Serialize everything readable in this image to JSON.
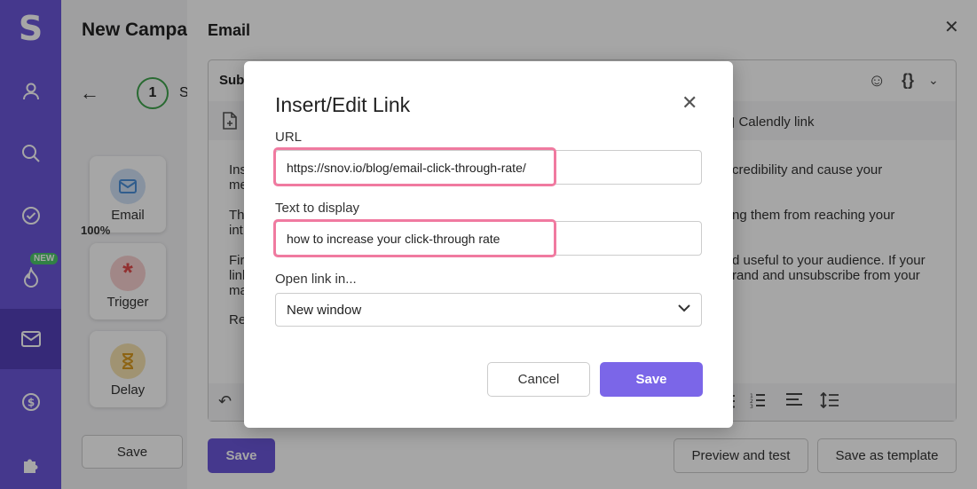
{
  "sidebar": {
    "logo": "S",
    "new_badge": "NEW"
  },
  "campaign": {
    "title": "New Campaign",
    "step_number": "1",
    "step_label_partial": "S",
    "nodes": [
      {
        "label": "Email",
        "icon": "envelope-icon",
        "color": "#4a90d9"
      },
      {
        "label": "Trigger",
        "icon": "asterisk-icon",
        "color": "#e04a4a"
      },
      {
        "label": "Delay",
        "icon": "hourglass-icon",
        "color": "#d99a1e"
      }
    ],
    "percent": "100%",
    "save_label": "Save"
  },
  "email_panel": {
    "title": "Email",
    "subject_label": "Subj",
    "calendly_label": "Calendly link",
    "body_fragments": [
      "Ins",
      "me",
      "Th",
      "int",
      "Fir",
      "link",
      "ma",
      "Re",
      "credibility and cause your",
      "ng them from reaching your",
      "d useful to your audience. If your",
      "rand and unsubscribe from your"
    ],
    "save_label": "Save",
    "preview_label": "Preview and test",
    "template_label": "Save as template"
  },
  "dialog": {
    "title": "Insert/Edit Link",
    "url_label": "URL",
    "url_value": "https://snov.io/blog/email-click-through-rate/",
    "text_label": "Text to display",
    "text_value": "how to increase your click-through rate",
    "open_label": "Open link in...",
    "open_value": "New window",
    "cancel_label": "Cancel",
    "save_label": "Save"
  },
  "colors": {
    "accent": "#6b57d9",
    "highlight": "#f07aa0"
  }
}
